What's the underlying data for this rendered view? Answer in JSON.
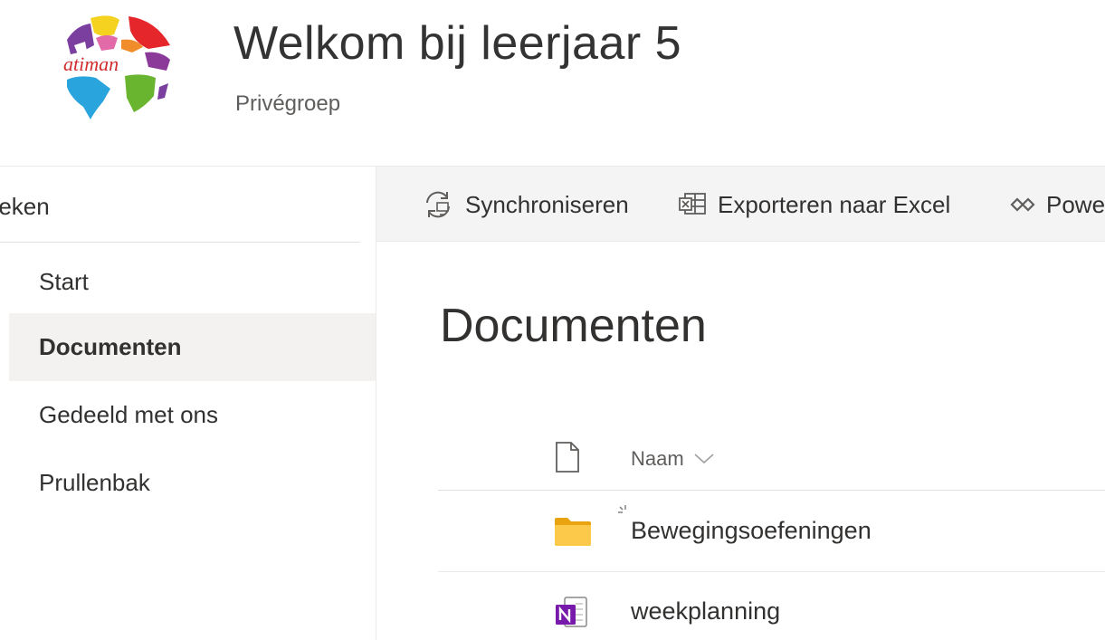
{
  "site": {
    "title": "Welkom bij leerjaar 5",
    "subtitle": "Privégroep",
    "logo_text": "atiman"
  },
  "search": {
    "placeholder": "Zoeken"
  },
  "nav": {
    "items": [
      {
        "label": "Start"
      },
      {
        "label": "Documenten",
        "selected": true
      },
      {
        "label": "Gedeeld met ons"
      },
      {
        "label": "Prullenbak"
      }
    ]
  },
  "commandbar": {
    "sync_label": "Synchroniseren",
    "excel_label": "Exporteren naar Excel",
    "power_label": "PowerApps"
  },
  "main": {
    "heading": "Documenten",
    "columns": {
      "name": "Naam"
    },
    "rows": [
      {
        "name": "Bewegingsoefeningen",
        "type": "folder-icon"
      },
      {
        "name": "weekplanning",
        "type": "onenote-icon"
      }
    ]
  },
  "colors": {
    "selected_bg": "#f3f2f1",
    "commandbar_bg": "#f4f4f4",
    "folder": "#f8c43b",
    "onenote": "#7719aa"
  }
}
